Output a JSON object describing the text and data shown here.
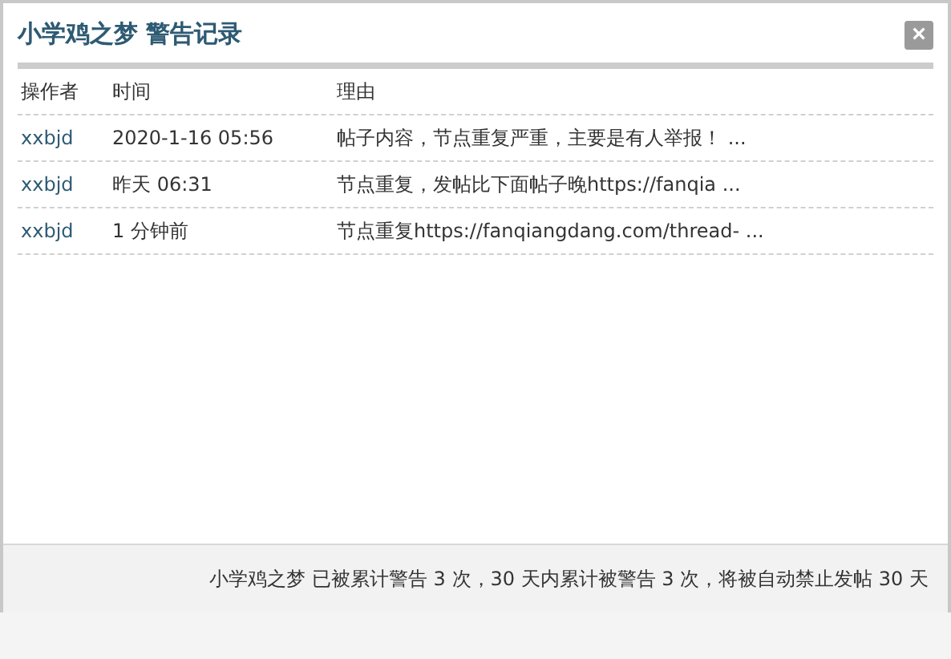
{
  "window": {
    "title": "小学鸡之梦 警告记录",
    "close": "×"
  },
  "table": {
    "columns": [
      "操作者",
      "时间",
      "理由"
    ],
    "rows": [
      {
        "operator": "xxbjd",
        "time": "2020-1-16 05:56",
        "reason": "帖子内容，节点重复严重，主要是有人举报！ ..."
      },
      {
        "operator": "xxbjd",
        "time": "昨天 06:31",
        "reason": "节点重复，发帖比下面帖子晚https://fanqia ..."
      },
      {
        "operator": "xxbjd",
        "time": "1 分钟前",
        "reason": "节点重复https://fanqiangdang.com/thread- ..."
      }
    ]
  },
  "footer": "小学鸡之梦 已被累计警告 3 次，30 天内累计被警告 3 次，将被自动禁止发帖 30 天"
}
